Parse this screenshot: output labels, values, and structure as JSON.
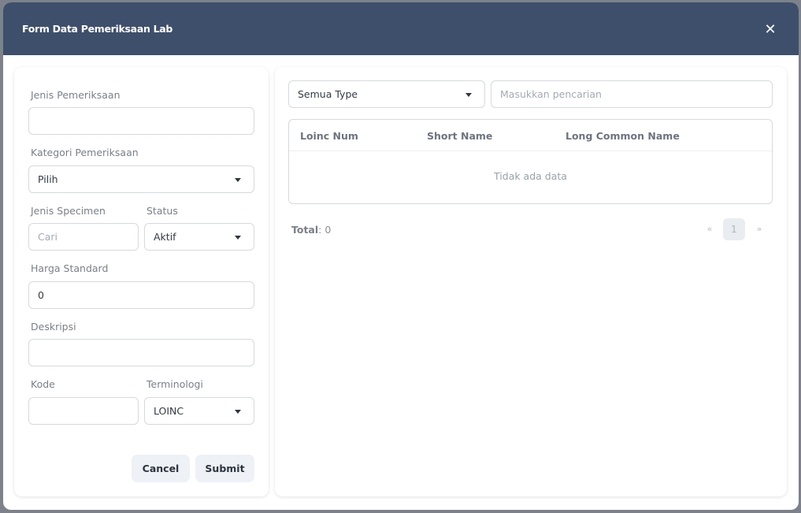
{
  "modal": {
    "title": "Form Data Pemeriksaan Lab",
    "close_icon": "close-icon"
  },
  "form": {
    "jenis_pemeriksaan": {
      "label": "Jenis Pemeriksaan",
      "value": ""
    },
    "kategori_pemeriksaan": {
      "label": "Kategori Pemeriksaan",
      "value": "Pilih"
    },
    "jenis_specimen": {
      "label": "Jenis Specimen",
      "placeholder": "Cari",
      "value": ""
    },
    "status": {
      "label": "Status",
      "value": "Aktif"
    },
    "harga_standard": {
      "label": "Harga Standard",
      "value": "0"
    },
    "deskripsi": {
      "label": "Deskripsi",
      "value": ""
    },
    "kode": {
      "label": "Kode",
      "value": ""
    },
    "terminologi": {
      "label": "Terminologi",
      "value": "LOINC"
    },
    "cancel_label": "Cancel",
    "submit_label": "Submit"
  },
  "search_panel": {
    "type_filter": "Semua Type",
    "search_placeholder": "Masukkan pencarian",
    "table": {
      "columns": [
        "Loinc Num",
        "Short Name",
        "Long Common Name"
      ],
      "rows": [],
      "empty_text": "Tidak ada data"
    },
    "total_label": "Total",
    "total_value": ": 0",
    "pagination": {
      "prev": "«",
      "current": "1",
      "next": "»"
    }
  }
}
